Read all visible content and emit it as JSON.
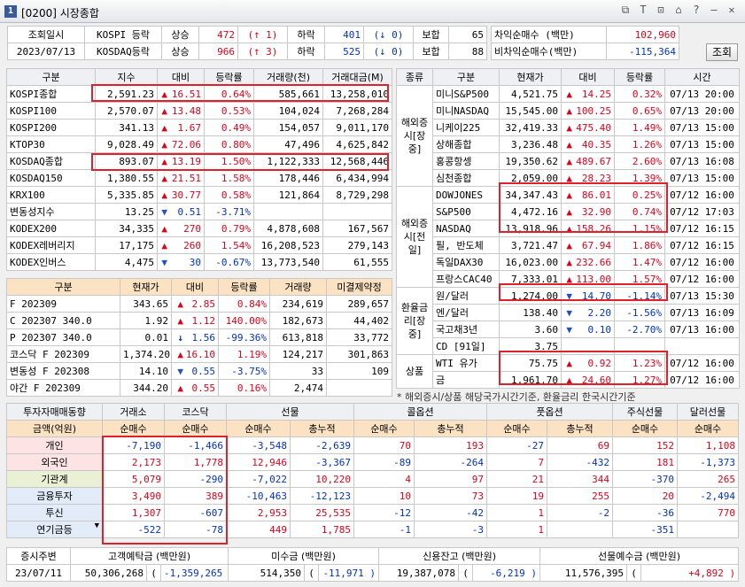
{
  "window": {
    "icon": "1",
    "title": "[0200] 시장종합"
  },
  "top": {
    "inquiry_label": "조회일시",
    "date": "2023/07/13",
    "rows": [
      {
        "name": "KOSPI 등락",
        "rise_label": "상승",
        "rise": "472",
        "up_limit": "1",
        "fall_label": "하락",
        "fall": "401",
        "down_limit": "0",
        "flat_label": "보합",
        "flat": "65"
      },
      {
        "name": "KOSDAQ등락",
        "rise_label": "상승",
        "rise": "966",
        "up_limit": "3",
        "fall_label": "하락",
        "fall": "525",
        "down_limit": "0",
        "flat_label": "보합",
        "flat": "88"
      }
    ],
    "arb": [
      {
        "label": "차익순매수  (백만)",
        "value": "102,960"
      },
      {
        "label": "비차익순매수(백만)",
        "value": "-115,364"
      }
    ],
    "search_btn": "조회"
  },
  "index": {
    "headers": [
      "구분",
      "지수",
      "대비",
      "등락률",
      "거래량(천)",
      "거래대금(M)"
    ],
    "rows": [
      {
        "name": "KOSPI종합",
        "v": "2,591.23",
        "d": "up",
        "c": "16.51",
        "p": "0.64%",
        "vol": "585,661",
        "amt": "13,258,010"
      },
      {
        "name": "KOSPI100",
        "v": "2,570.07",
        "d": "up",
        "c": "13.48",
        "p": "0.53%",
        "vol": "104,024",
        "amt": "7,268,284"
      },
      {
        "name": "KOSPI200",
        "v": "341.13",
        "d": "up",
        "c": "1.67",
        "p": "0.49%",
        "vol": "154,057",
        "amt": "9,011,170"
      },
      {
        "name": "KTOP30",
        "v": "9,028.49",
        "d": "up",
        "c": "72.06",
        "p": "0.80%",
        "vol": "47,496",
        "amt": "4,625,842"
      },
      {
        "name": "KOSDAQ종합",
        "v": "893.07",
        "d": "up",
        "c": "13.19",
        "p": "1.50%",
        "vol": "1,122,333",
        "amt": "12,568,446"
      },
      {
        "name": "KOSDAQ150",
        "v": "1,380.55",
        "d": "up",
        "c": "21.51",
        "p": "1.58%",
        "vol": "178,446",
        "amt": "6,434,994"
      },
      {
        "name": "KRX100",
        "v": "5,335.85",
        "d": "up",
        "c": "30.77",
        "p": "0.58%",
        "vol": "121,864",
        "amt": "8,729,298"
      },
      {
        "name": "변동성지수",
        "v": "13.25",
        "d": "dn",
        "c": "0.51",
        "p": "-3.71%",
        "vol": "",
        "amt": ""
      },
      {
        "name": "KODEX200",
        "v": "34,335",
        "d": "up",
        "c": "270",
        "p": "0.79%",
        "vol": "4,878,608",
        "amt": "167,567"
      },
      {
        "name": "KODEX레버리지",
        "v": "17,175",
        "d": "up",
        "c": "260",
        "p": "1.54%",
        "vol": "16,208,523",
        "amt": "279,143"
      },
      {
        "name": "KODEX인버스",
        "v": "4,475",
        "d": "dn",
        "c": "30",
        "p": "-0.67%",
        "vol": "13,773,540",
        "amt": "61,555"
      }
    ]
  },
  "futures": {
    "headers": [
      "구분",
      "현재가",
      "대비",
      "등락률",
      "거래량",
      "미결제약정"
    ],
    "rows": [
      {
        "name": "F 202309",
        "v": "343.65",
        "d": "up",
        "c": "2.85",
        "p": "0.84%",
        "vol": "234,619",
        "oi": "289,657"
      },
      {
        "name": "C 202307 340.0",
        "v": "1.92",
        "d": "up",
        "c": "1.12",
        "p": "140.00%",
        "vol": "182,673",
        "oi": "44,402"
      },
      {
        "name": "P 202307 340.0",
        "v": "0.01",
        "d": "dnarrow",
        "c": "1.56",
        "p": "-99.36%",
        "vol": "613,818",
        "oi": "33,772"
      },
      {
        "name": "코스닥 F 202309",
        "v": "1,374.20",
        "d": "up",
        "c": "16.10",
        "p": "1.19%",
        "vol": "124,217",
        "oi": "301,863"
      },
      {
        "name": "변동성 F 202308",
        "v": "14.10",
        "d": "dn",
        "c": "0.55",
        "p": "-3.75%",
        "vol": "33",
        "oi": "109"
      },
      {
        "name": "야간 F 202309",
        "v": "344.20",
        "d": "up",
        "c": "0.55",
        "p": "0.16%",
        "vol": "2,474",
        "oi": ""
      }
    ]
  },
  "world": {
    "headers": [
      "종류",
      "구분",
      "현재가",
      "대비",
      "등락률",
      "시간"
    ],
    "groups": [
      {
        "label": "해외증시[장중]",
        "rows": [
          {
            "name": "미니S&P500",
            "v": "4,521.75",
            "d": "up",
            "c": "14.25",
            "p": "0.32%",
            "t": "07/13 20:00"
          },
          {
            "name": "미니NASDAQ",
            "v": "15,545.00",
            "d": "up",
            "c": "100.25",
            "p": "0.65%",
            "t": "07/13 20:00"
          },
          {
            "name": "니케이225",
            "v": "32,419.33",
            "d": "up",
            "c": "475.40",
            "p": "1.49%",
            "t": "07/13 15:00"
          },
          {
            "name": "상해종합",
            "v": "3,236.48",
            "d": "up",
            "c": "40.35",
            "p": "1.26%",
            "t": "07/13 15:00"
          },
          {
            "name": "홍콩항셍",
            "v": "19,350.62",
            "d": "up",
            "c": "489.67",
            "p": "2.60%",
            "t": "07/13 16:08"
          },
          {
            "name": "심천종합",
            "v": "2,059.00",
            "d": "up",
            "c": "28.23",
            "p": "1.39%",
            "t": "07/13 15:00"
          }
        ]
      },
      {
        "label": "해외증시[전일]",
        "rows": [
          {
            "name": "DOWJONES",
            "v": "34,347.43",
            "d": "up",
            "c": "86.01",
            "p": "0.25%",
            "t": "07/12 16:00"
          },
          {
            "name": "S&P500",
            "v": "4,472.16",
            "d": "up",
            "c": "32.90",
            "p": "0.74%",
            "t": "07/12 17:03"
          },
          {
            "name": "NASDAQ",
            "v": "13,918.96",
            "d": "up",
            "c": "158.26",
            "p": "1.15%",
            "t": "07/12 16:15"
          },
          {
            "name": "필, 반도체",
            "v": "3,721.47",
            "d": "up",
            "c": "67.94",
            "p": "1.86%",
            "t": "07/12 16:15"
          },
          {
            "name": "독일DAX30",
            "v": "16,023.00",
            "d": "up",
            "c": "232.66",
            "p": "1.47%",
            "t": "07/12 16:00"
          },
          {
            "name": "프랑스CAC40",
            "v": "7,333.01",
            "d": "up",
            "c": "113.00",
            "p": "1.57%",
            "t": "07/12 16:00"
          }
        ]
      },
      {
        "label": "환율금리[장중]",
        "rows": [
          {
            "name": "원/달러",
            "v": "1,274.00",
            "d": "dn",
            "c": "14.70",
            "p": "-1.14%",
            "t": "07/13 15:30"
          },
          {
            "name": "엔/달러",
            "v": "138.40",
            "d": "dn",
            "c": "2.20",
            "p": "-1.56%",
            "t": "07/13 16:09"
          },
          {
            "name": "국고채3년",
            "v": "3.60",
            "d": "dn",
            "c": "0.10",
            "p": "-2.70%",
            "t": "07/13 16:00"
          },
          {
            "name": "CD [91일]",
            "v": "3.75",
            "d": "",
            "c": "",
            "p": "",
            "t": ""
          }
        ]
      },
      {
        "label": "상품",
        "rows": [
          {
            "name": "WTI 유가",
            "v": "75.75",
            "d": "up",
            "c": "0.92",
            "p": "1.23%",
            "t": "07/12 16:00"
          },
          {
            "name": "금",
            "v": "1,961.70",
            "d": "up",
            "c": "24.60",
            "p": "1.27%",
            "t": "07/12 16:00"
          }
        ]
      }
    ],
    "note": "* 해외증시/상품 해당국가시간기준, 환율금리 한국시간기준"
  },
  "investor": {
    "title": "투자자매매동향",
    "unit": "금액(억원)",
    "groups": [
      "거래소",
      "코스닥",
      "선물",
      "콜옵션",
      "풋옵션",
      "주식선물",
      "달러선물"
    ],
    "subs": [
      "순매수",
      "순매수",
      "순매수",
      "총누적",
      "순매수",
      "총누적",
      "순매수",
      "총누적",
      "순매수",
      "순매수"
    ],
    "rows": [
      {
        "name": "개인",
        "v": [
          "-7,190",
          "-1,466",
          "-3,548",
          "-2,639",
          "70",
          "193",
          "-27",
          "69",
          "152",
          "1,108"
        ]
      },
      {
        "name": "외국인",
        "v": [
          "2,173",
          "1,778",
          "12,946",
          "-3,367",
          "-89",
          "-264",
          "7",
          "-432",
          "181",
          "-1,373"
        ]
      },
      {
        "name": "기관계",
        "v": [
          "5,079",
          "-290",
          "-7,022",
          "10,220",
          "4",
          "97",
          "21",
          "344",
          "-370",
          "265"
        ]
      },
      {
        "name": "금융투자",
        "v": [
          "3,490",
          "389",
          "-10,463",
          "-12,123",
          "10",
          "73",
          "19",
          "255",
          "20",
          "-2,494"
        ]
      },
      {
        "name": "투신",
        "v": [
          "1,307",
          "-607",
          "2,953",
          "25,535",
          "-12",
          "-42",
          "1",
          "-2",
          "-36",
          "770"
        ]
      },
      {
        "name": "연기금등",
        "v": [
          "-522",
          "-78",
          "449",
          "1,785",
          "-1",
          "-3",
          "1",
          "",
          "-351",
          ""
        ]
      }
    ]
  },
  "bottom": {
    "headers": [
      "증시주변",
      "고객예탁금 (백만원)",
      "미수금 (백만원)",
      "신용잔고 (백만원)",
      "선물예수금 (백만원)"
    ],
    "date": "23/07/11",
    "deposit": "50,306,268",
    "deposit_chg": "-1,359,265",
    "unpaid": "514,350",
    "unpaid_chg": "-11,971",
    "credit": "19,387,078",
    "credit_chg": "-6,219",
    "fut": "11,576,395",
    "fut_chg": "+4,892"
  },
  "colors": {
    "red": "#e0001a",
    "blue": "#0031c8",
    "header": "#eef0f4",
    "orange": "#fbe2c2"
  }
}
